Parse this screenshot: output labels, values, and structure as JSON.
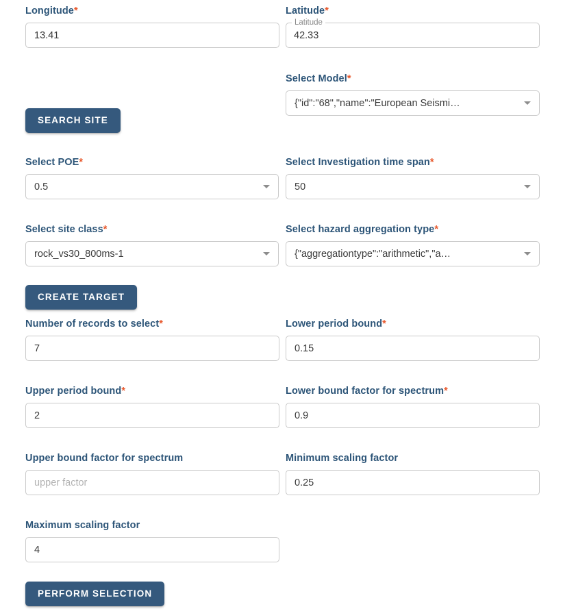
{
  "form": {
    "fields": [
      {
        "key": "longitude",
        "name": "longitude",
        "label": "Longitude",
        "required": true,
        "type": "text",
        "value": "13.41",
        "placeholder": ""
      },
      {
        "key": "latitude",
        "name": "latitude",
        "label": "Latitude",
        "required": true,
        "type": "outlined-text",
        "floating_label": "Latitude",
        "value": "42.33",
        "placeholder": ""
      },
      {
        "key": "select_model",
        "name": "select-model",
        "label": "Select Model",
        "required": true,
        "type": "select",
        "value": "{\"id\":\"68\",\"name\":\"European Seismi…"
      },
      {
        "key": "select_poe",
        "name": "select-poe",
        "label": "Select POE",
        "required": true,
        "type": "select",
        "value": "0.5"
      },
      {
        "key": "investigation_time_span",
        "name": "select-investigation-time-span",
        "label": "Select Investigation time span",
        "required": true,
        "type": "select",
        "value": "50"
      },
      {
        "key": "site_class",
        "name": "select-site-class",
        "label": "Select site class",
        "required": true,
        "type": "select",
        "value": "rock_vs30_800ms-1"
      },
      {
        "key": "hazard_aggregation_type",
        "name": "select-hazard-aggregation-type",
        "label": "Select hazard aggregation type",
        "required": true,
        "type": "select",
        "value": "{\"aggregationtype\":\"arithmetic\",\"a…"
      },
      {
        "key": "number_of_records",
        "name": "number-of-records-to-select",
        "label": "Number of records to select",
        "required": true,
        "type": "text",
        "value": "7",
        "placeholder": ""
      },
      {
        "key": "lower_period_bound",
        "name": "lower-period-bound",
        "label": "Lower period bound",
        "required": true,
        "type": "text",
        "value": "0.15",
        "placeholder": ""
      },
      {
        "key": "upper_period_bound",
        "name": "upper-period-bound",
        "label": "Upper period bound",
        "required": true,
        "type": "text",
        "value": "2",
        "placeholder": ""
      },
      {
        "key": "lower_bound_factor",
        "name": "lower-bound-factor-for-spectrum",
        "label": "Lower bound factor for spectrum",
        "required": true,
        "type": "text",
        "value": "0.9",
        "placeholder": ""
      },
      {
        "key": "upper_bound_factor",
        "name": "upper-bound-factor-for-spectrum",
        "label": "Upper bound factor for spectrum",
        "required": false,
        "type": "text",
        "value": "",
        "placeholder": "upper factor"
      },
      {
        "key": "minimum_scaling_factor",
        "name": "minimum-scaling-factor",
        "label": "Minimum scaling factor",
        "required": false,
        "type": "text",
        "value": "0.25",
        "placeholder": ""
      },
      {
        "key": "maximum_scaling_factor",
        "name": "maximum-scaling-factor",
        "label": "Maximum scaling factor",
        "required": false,
        "type": "text",
        "value": "4",
        "placeholder": ""
      }
    ],
    "buttons": {
      "search_site": "SEARCH SITE",
      "create_target": "CREATE TARGET",
      "perform_selection": "PERFORM SELECTION"
    }
  },
  "theme": {
    "label_color": "#2d5578",
    "required_marker_color": "#e8582c",
    "button_bg": "#35597d",
    "button_text": "#ffffff",
    "input_border": "#c9c9c9",
    "value_text": "#3a3a3a",
    "placeholder_text": "#b3b3b3",
    "page_bg": "#ffffff"
  }
}
